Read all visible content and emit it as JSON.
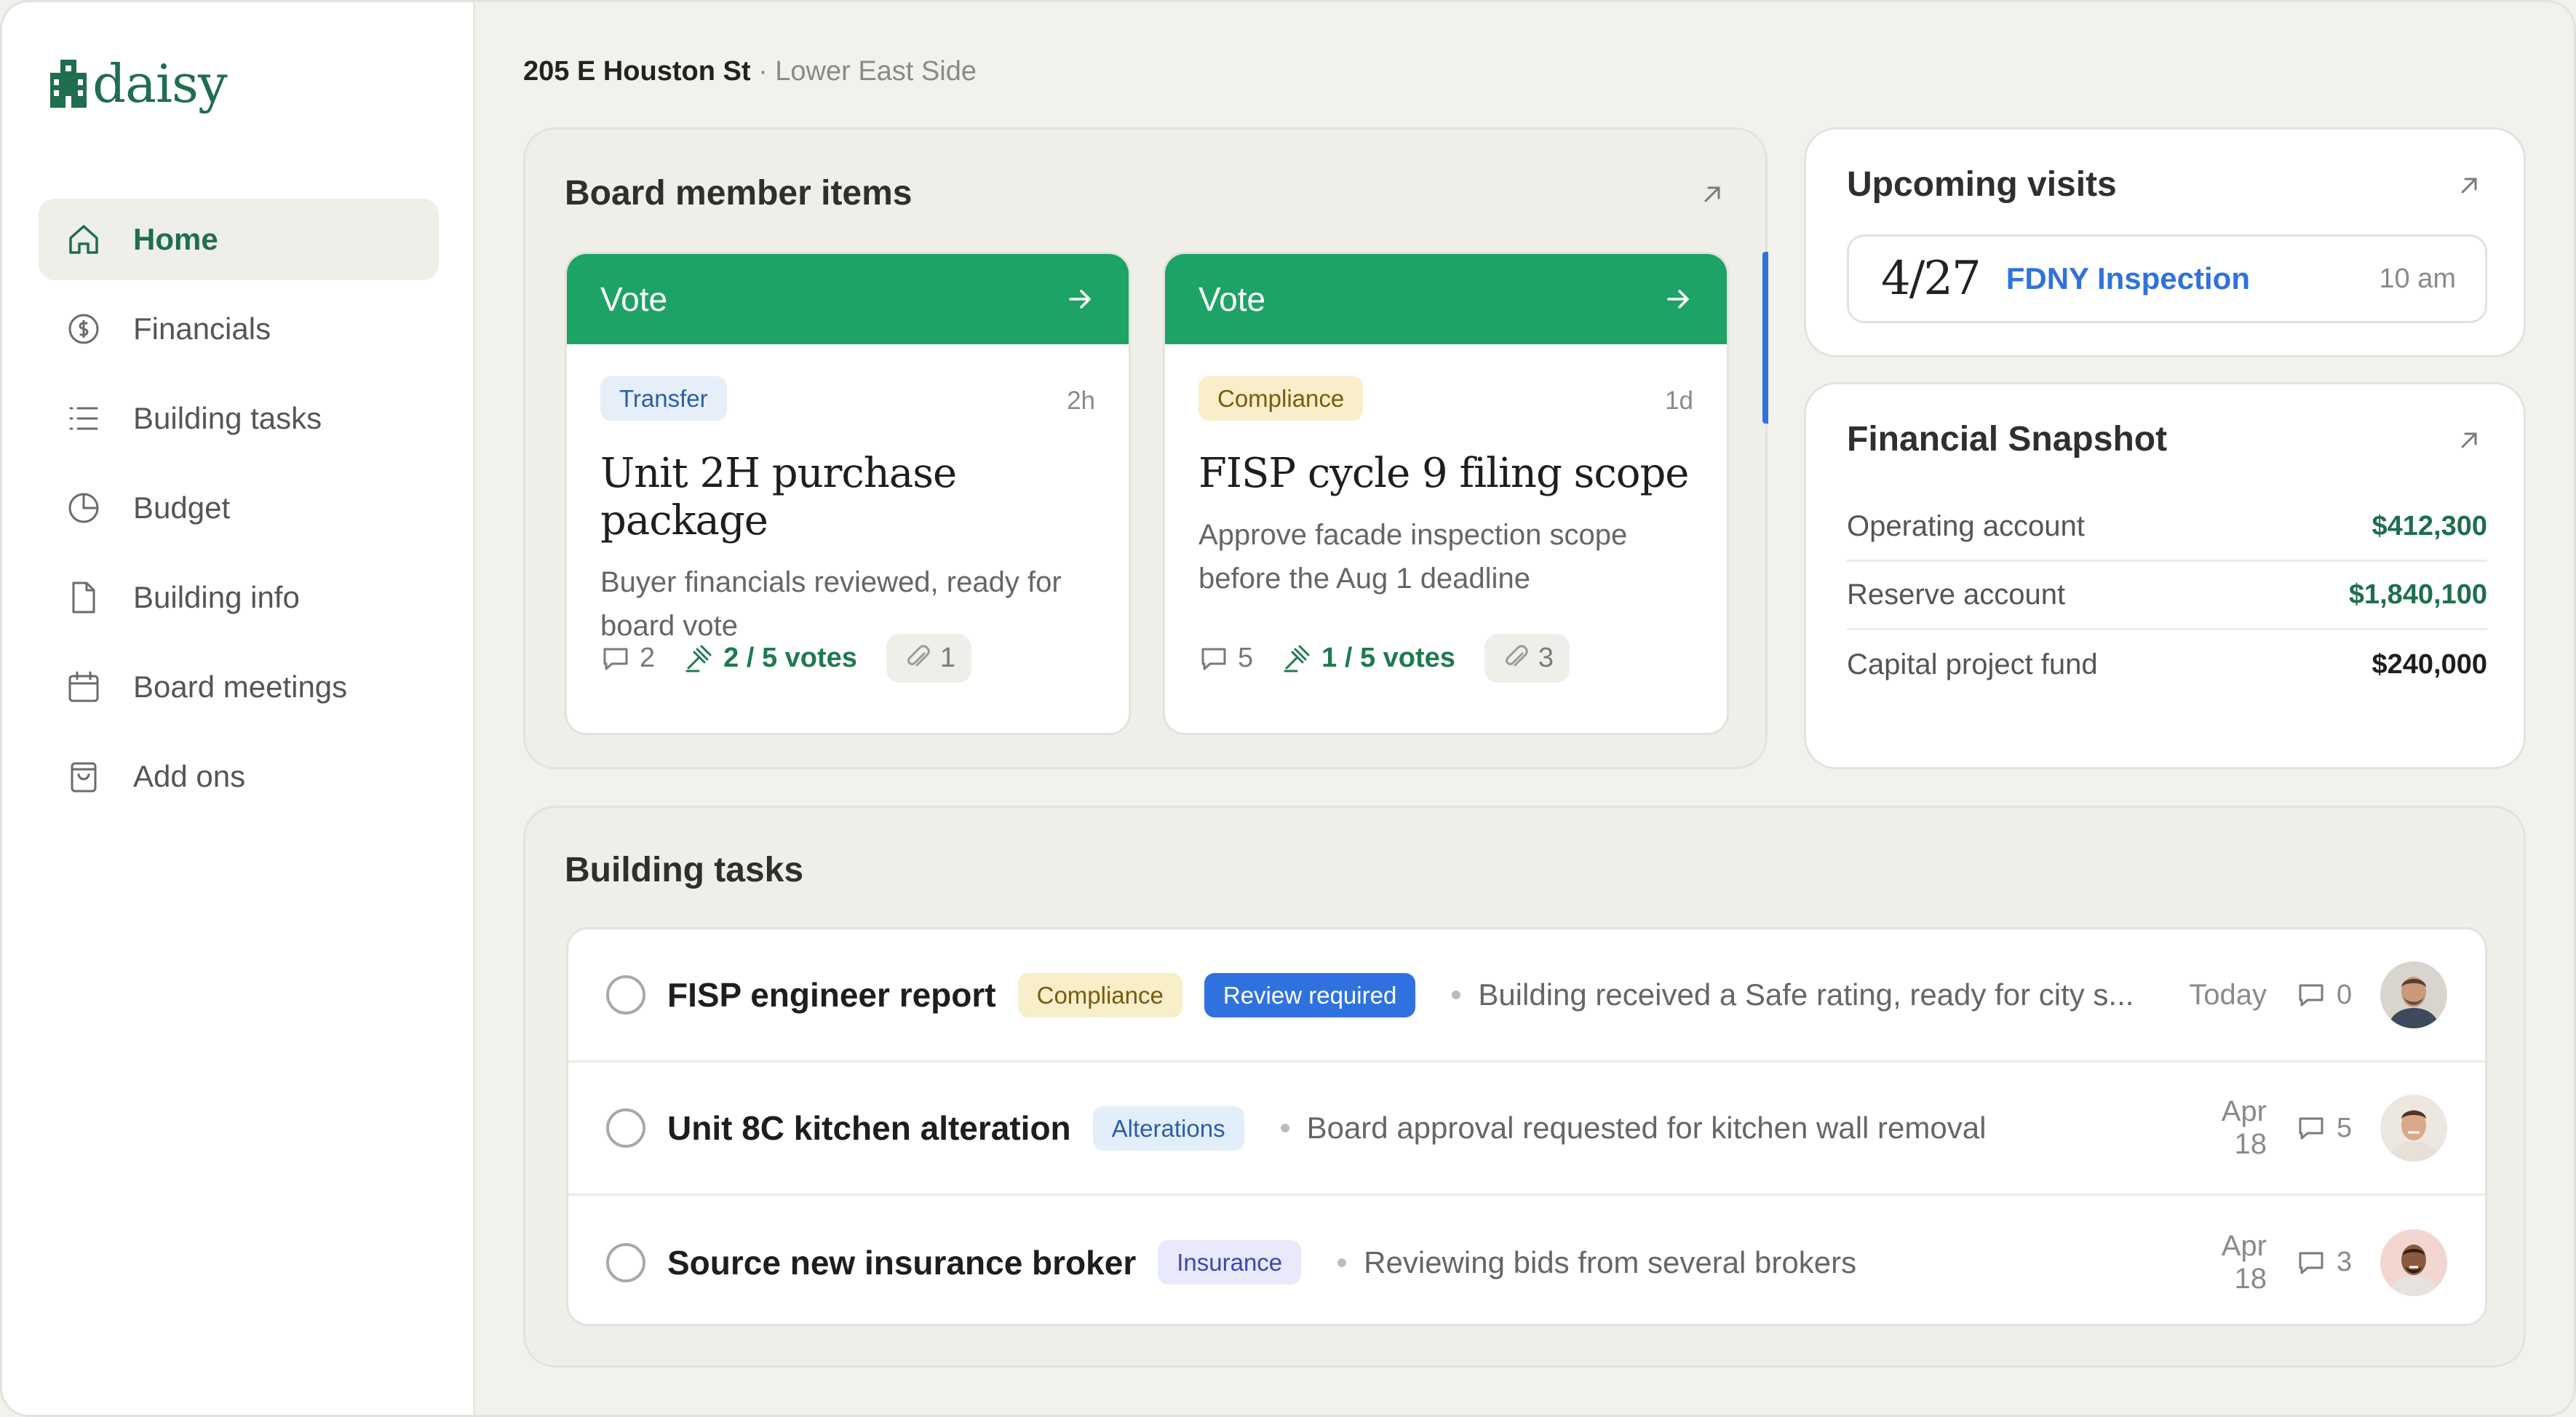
{
  "app": {
    "brand": "daisy",
    "brand_color": "#1f6e4e",
    "accent_green": "#1ea366",
    "accent_blue": "#2f72df"
  },
  "sidebar": {
    "items": [
      {
        "label": "Home",
        "icon": "home-icon",
        "active": true
      },
      {
        "label": "Financials",
        "icon": "dollar-circle-icon"
      },
      {
        "label": "Building tasks",
        "icon": "list-icon"
      },
      {
        "label": "Budget",
        "icon": "pie-chart-icon"
      },
      {
        "label": "Building info",
        "icon": "document-icon"
      },
      {
        "label": "Board meetings",
        "icon": "calendar-icon"
      },
      {
        "label": "Add ons",
        "icon": "shopping-bag-icon"
      }
    ]
  },
  "header": {
    "street": "205 E Houston St",
    "neighborhood": "· Lower East Side"
  },
  "board": {
    "title": "Board member items",
    "cards": [
      {
        "header": "Vote",
        "tag": "Transfer",
        "age": "2h",
        "title": "Unit 2H purchase package",
        "description": "Buyer financials reviewed, ready for board vote",
        "comments": "2",
        "votes": "2 / 5 votes",
        "attachments": "1"
      },
      {
        "header": "Vote",
        "tag": "Compliance",
        "age": "1d",
        "title": "FISP cycle 9 filing scope",
        "description": "Approve facade inspection scope before the Aug 1 deadline",
        "comments": "5",
        "votes": "1 / 5 votes",
        "attachments": "3"
      }
    ]
  },
  "visits": {
    "title": "Upcoming visits",
    "items": [
      {
        "date": "4/27",
        "name": "FDNY Inspection",
        "time": "10 am"
      }
    ]
  },
  "financials": {
    "title": "Financial Snapshot",
    "rows": [
      {
        "label": "Operating account",
        "value": "$412,300",
        "color": "#1f6e4e"
      },
      {
        "label": "Reserve account",
        "value": "$1,840,100",
        "color": "#1f6e4e"
      },
      {
        "label": "Capital project fund",
        "value": "$240,000",
        "color": "#1e1e1e"
      }
    ]
  },
  "tasks": {
    "title": "Building tasks",
    "items": [
      {
        "title": "FISP engineer report",
        "tags": [
          "Compliance",
          "Review required"
        ],
        "description": "Building received a Safe rating, ready for city s...",
        "date": "Today",
        "comments": "0"
      },
      {
        "title": "Unit 8C kitchen alteration",
        "tags": [
          "Alterations"
        ],
        "description": "Board approval requested for kitchen wall removal",
        "date": "Apr 18",
        "comments": "5"
      },
      {
        "title": "Source new insurance broker",
        "tags": [
          "Insurance"
        ],
        "description": "Reviewing bids from several brokers",
        "date": "Apr 18",
        "comments": "3"
      }
    ]
  }
}
